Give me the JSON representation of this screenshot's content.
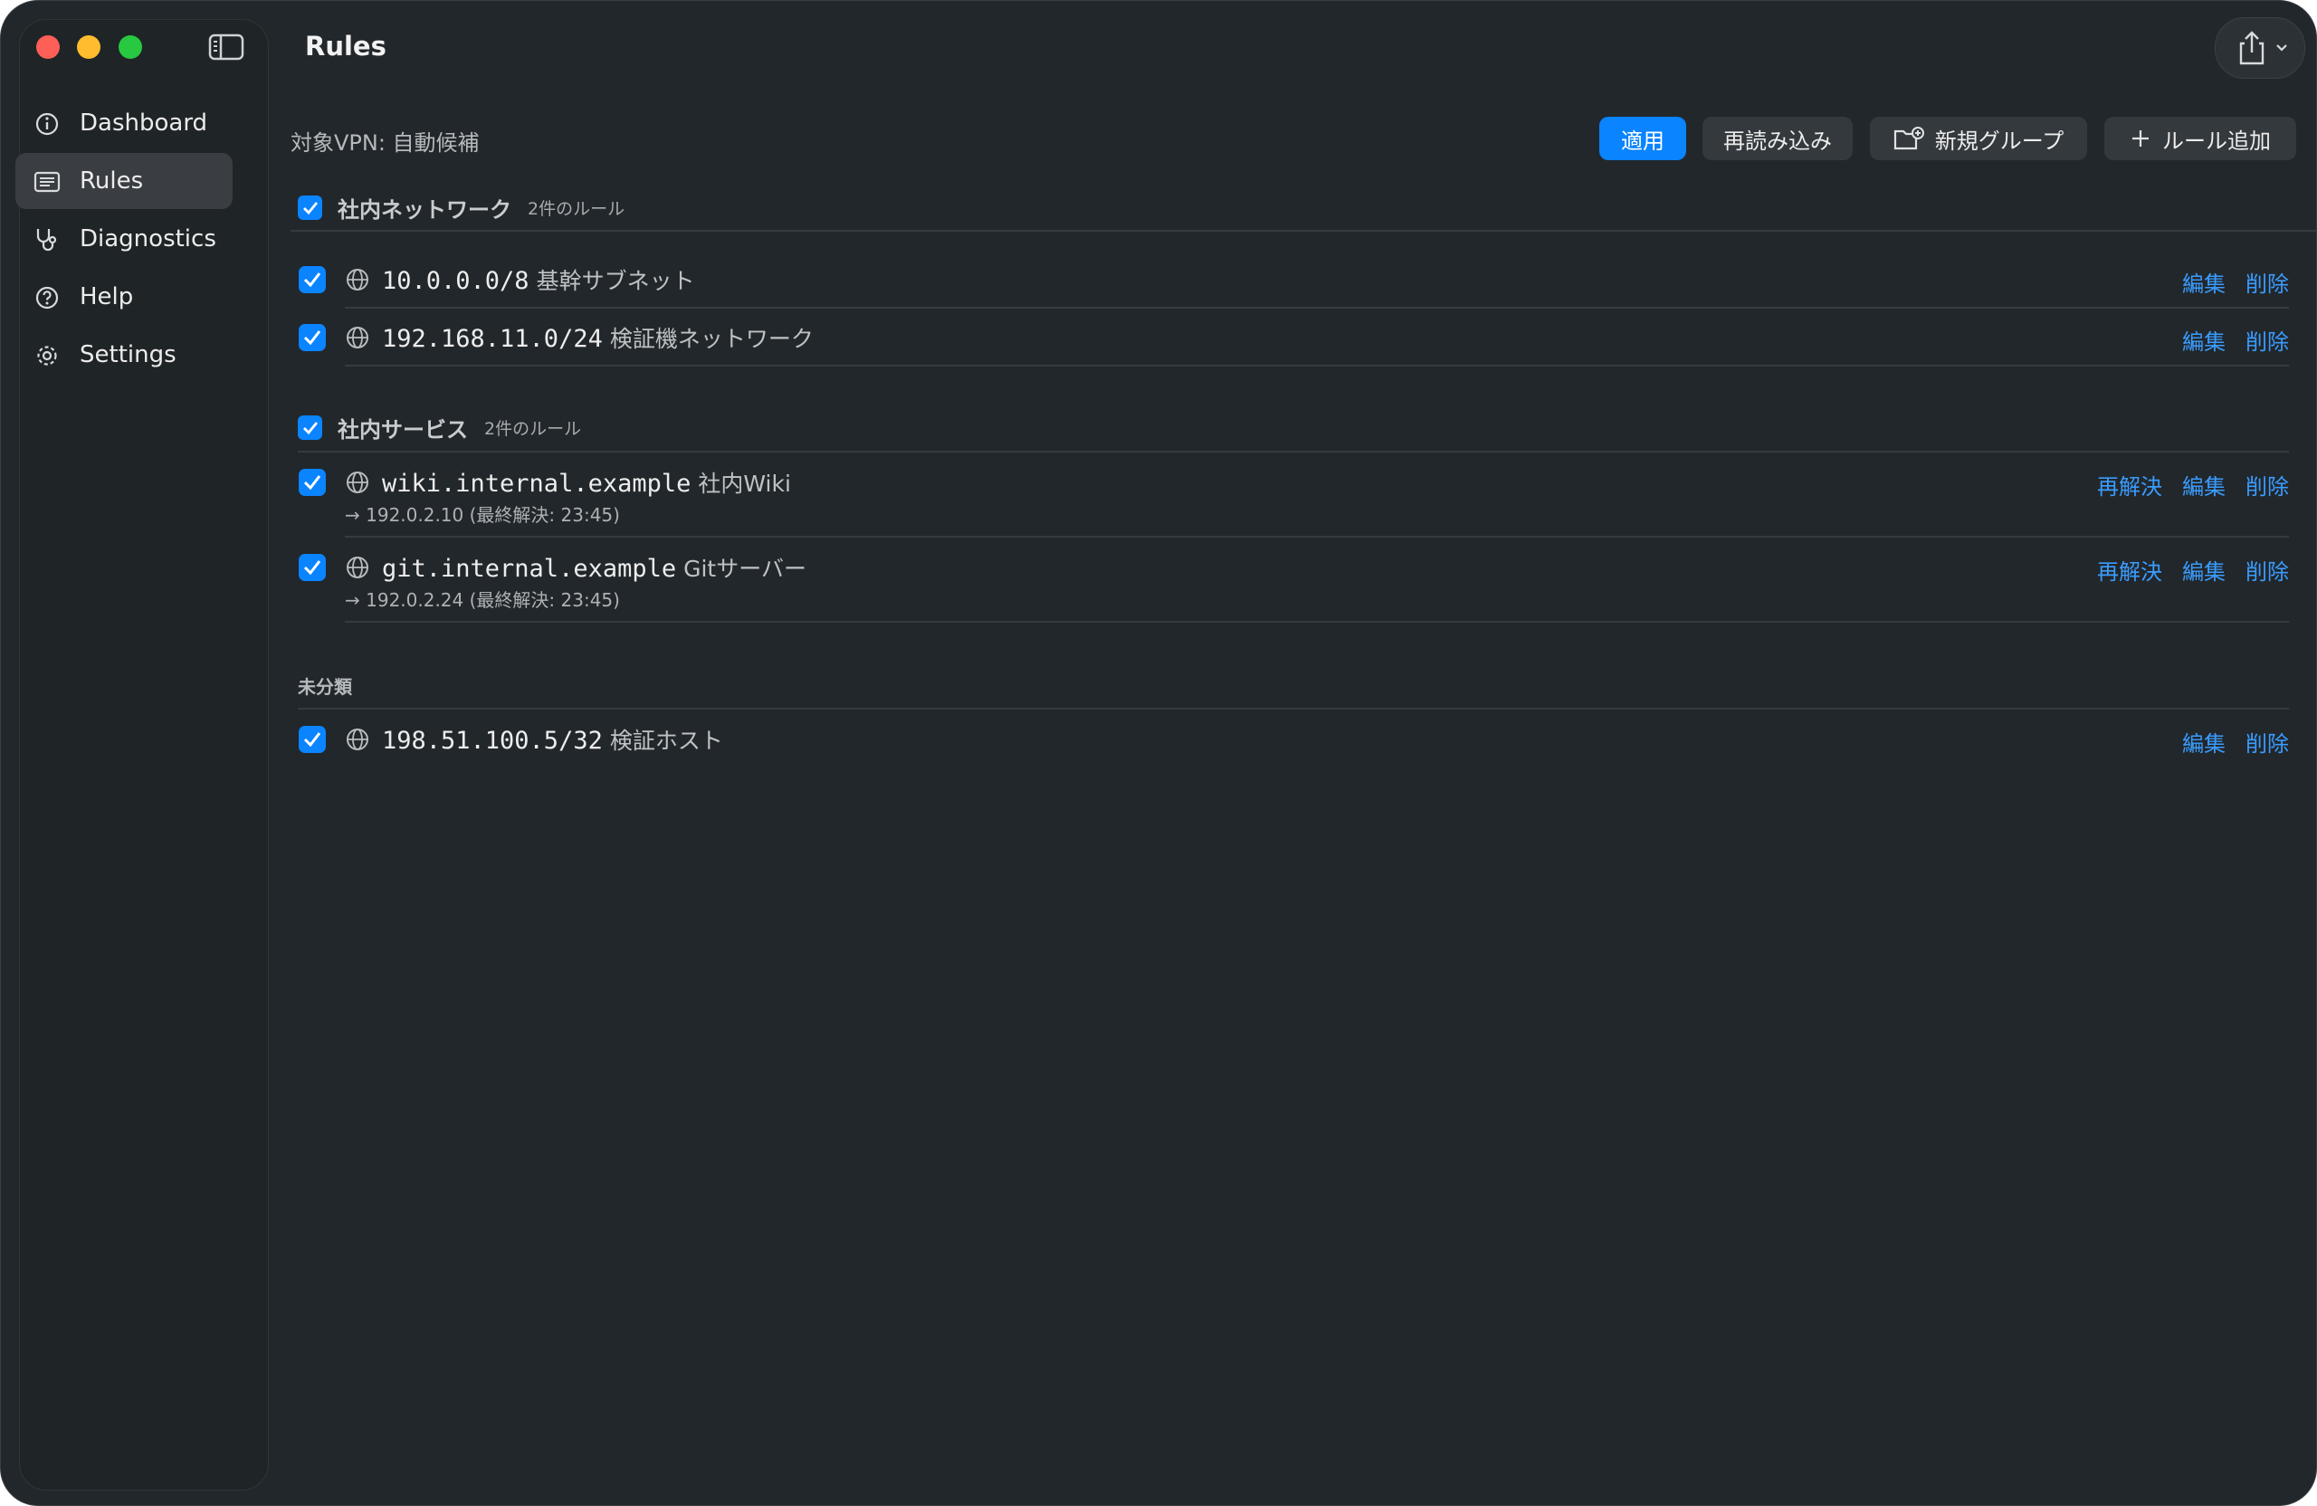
{
  "window": {
    "title": "Rules"
  },
  "sidebar": {
    "items": [
      {
        "label": "Dashboard",
        "icon": "info-circle-icon",
        "active": false
      },
      {
        "label": "Rules",
        "icon": "list-icon",
        "active": true
      },
      {
        "label": "Diagnostics",
        "icon": "stethoscope-icon",
        "active": false
      },
      {
        "label": "Help",
        "icon": "question-circle-icon",
        "active": false
      },
      {
        "label": "Settings",
        "icon": "gear-icon",
        "active": false
      }
    ]
  },
  "toolbar": {
    "target_vpn": "対象VPN: 自動候補",
    "apply_label": "適用",
    "reload_label": "再読み込み",
    "new_group_label": "新規グループ",
    "add_rule_label": "ルール追加"
  },
  "groups": [
    {
      "title": "社内ネットワーク",
      "count": "2件のルール",
      "enabled": true,
      "rules": [
        {
          "target": "10.0.0.0/8",
          "desc": "基幹サブネット",
          "edit": "編集",
          "delete": "削除"
        },
        {
          "target": "192.168.11.0/24",
          "desc": "検証機ネットワーク",
          "edit": "編集",
          "delete": "削除"
        }
      ]
    },
    {
      "title": "社内サービス",
      "count": "2件のルール",
      "enabled": true,
      "rules": [
        {
          "target": "wiki.internal.example",
          "desc": "社内Wiki",
          "resolved": "→ 192.0.2.10 (最終解決: 23:45)",
          "reresolve": "再解決",
          "edit": "編集",
          "delete": "削除"
        },
        {
          "target": "git.internal.example",
          "desc": "Gitサーバー",
          "resolved": "→ 192.0.2.24 (最終解決: 23:45)",
          "reresolve": "再解決",
          "edit": "編集",
          "delete": "削除"
        }
      ]
    },
    {
      "title": "未分類",
      "rules": [
        {
          "target": "198.51.100.5/32",
          "desc": "検証ホスト",
          "edit": "編集",
          "delete": "削除"
        }
      ]
    }
  ],
  "colors": {
    "accent": "#0a84ff",
    "link": "#3a9cff",
    "background": "#22272b",
    "sidebar": "#1f2427"
  }
}
